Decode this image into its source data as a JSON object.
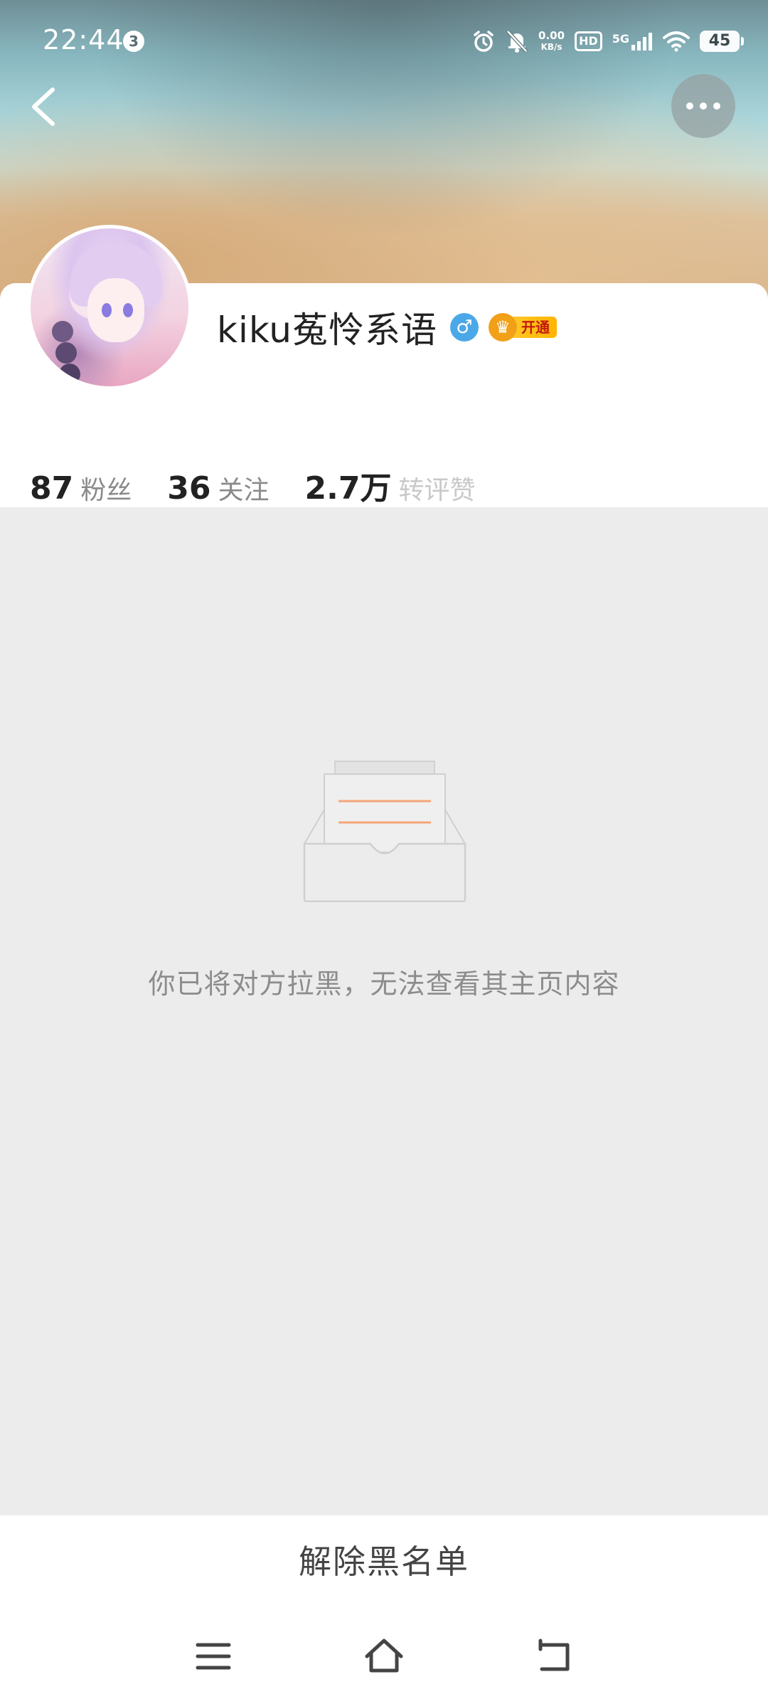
{
  "status_bar": {
    "time": "22:44",
    "notification_count": "3",
    "net_speed_value": "0.00",
    "net_speed_unit": "KB/s",
    "hd_label": "HD",
    "network_type": "5G",
    "battery_level": "45"
  },
  "profile": {
    "username": "kiku菟怜系语",
    "gender_symbol": "♂",
    "vip_label": "开通",
    "stats": [
      {
        "value": "87",
        "label": "粉丝"
      },
      {
        "value": "36",
        "label": "关注"
      },
      {
        "value": "2.7万",
        "label": "转评赞"
      }
    ]
  },
  "empty_state": {
    "message": "你已将对方拉黑，无法查看其主页内容"
  },
  "actions": {
    "unblock_label": "解除黑名单"
  },
  "colors": {
    "accent_orange": "#f5a67a",
    "gender_blue": "#4ba8e8",
    "vip_gold": "#ffb400",
    "background_gray": "#ececec"
  }
}
